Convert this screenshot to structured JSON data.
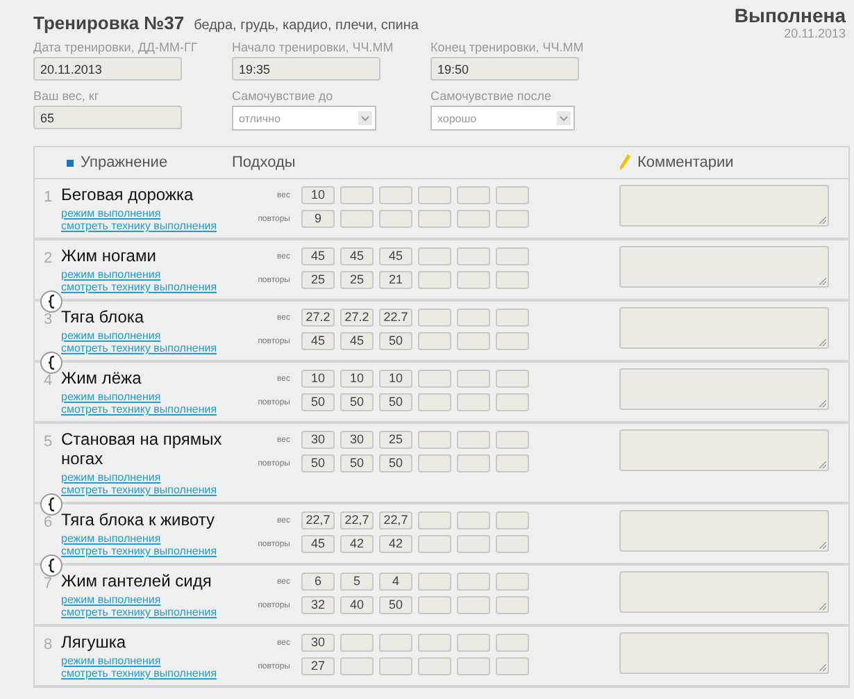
{
  "workout": {
    "title": "Тренировка №37",
    "muscles": "бедра, грудь, кардио, плечи, спина",
    "status": "Выполнена",
    "status_date": "20.11.2013"
  },
  "fields": [
    {
      "kind": "text",
      "label": "Дата тренировки, ДД-ММ-ГГ",
      "value": "20.11.2013"
    },
    {
      "kind": "text",
      "label": "Начало тренировки, ЧЧ.ММ",
      "value": "19:35"
    },
    {
      "kind": "text",
      "label": "Конец тренировки, ЧЧ.ММ",
      "value": "19:50"
    },
    {
      "kind": "text",
      "label": "Ваш вес, кг",
      "value": "65"
    },
    {
      "kind": "select",
      "label": "Самочувствие до",
      "value": "отлично"
    },
    {
      "kind": "select",
      "label": "Самочувствие после",
      "value": "хорошо"
    }
  ],
  "table": {
    "columns": [
      "Упражнение",
      "Подходы",
      "Комментарии"
    ],
    "rows": [
      {
        "number": "1",
        "name": "Беговая дорожка",
        "link_mode": "режим выполнения",
        "link_technique": "смотреть технику выполнения",
        "weight_label": "вес",
        "reps_label": "повторы",
        "weights": [
          "10"
        ],
        "reps": [
          "9"
        ],
        "superset_with_next": false
      },
      {
        "number": "2",
        "name": "Жим ногами",
        "link_mode": "режим выполнения",
        "link_technique": "смотреть технику выполнения",
        "weight_label": "вес",
        "reps_label": "повторы",
        "weights": [
          "45",
          "45",
          "45"
        ],
        "reps": [
          "25",
          "25",
          "21"
        ],
        "superset_with_next": true
      },
      {
        "number": "3",
        "name": "Тяга блока",
        "link_mode": "режим выполнения",
        "link_technique": "смотреть технику выполнения",
        "weight_label": "вес",
        "reps_label": "повторы",
        "weights": [
          "27.2",
          "27.2",
          "22.7"
        ],
        "reps": [
          "45",
          "45",
          "50"
        ],
        "superset_with_next": true
      },
      {
        "number": "4",
        "name": "Жим лёжа",
        "link_mode": "режим выполнения",
        "link_technique": "смотреть технику выполнения",
        "weight_label": "вес",
        "reps_label": "повторы",
        "weights": [
          "10",
          "10",
          "10"
        ],
        "reps": [
          "50",
          "50",
          "50"
        ],
        "superset_with_next": false
      },
      {
        "number": "5",
        "name": "Становая на прямых ногах",
        "link_mode": "режим выполнения",
        "link_technique": "смотреть технику выполнения",
        "weight_label": "вес",
        "reps_label": "повторы",
        "weights": [
          "30",
          "30",
          "25"
        ],
        "reps": [
          "50",
          "50",
          "50"
        ],
        "superset_with_next": true
      },
      {
        "number": "6",
        "name": "Тяга блока к животу",
        "link_mode": "режим выполнения",
        "link_technique": "смотреть технику выполнения",
        "weight_label": "вес",
        "reps_label": "повторы",
        "weights": [
          "22,7",
          "22,7",
          "22,7"
        ],
        "reps": [
          "45",
          "42",
          "42"
        ],
        "superset_with_next": true
      },
      {
        "number": "7",
        "name": "Жим гантелей сидя",
        "link_mode": "режим выполнения",
        "link_technique": "смотреть технику выполнения",
        "weight_label": "вес",
        "reps_label": "повторы",
        "weights": [
          "6",
          "5",
          "4"
        ],
        "reps": [
          "32",
          "40",
          "50"
        ],
        "superset_with_next": false
      },
      {
        "number": "8",
        "name": "Лягушка",
        "link_mode": "режим выполнения",
        "link_technique": "смотреть технику выполнения",
        "weight_label": "вес",
        "reps_label": "повторы",
        "weights": [
          "30"
        ],
        "reps": [
          "27"
        ],
        "superset_with_next": false
      }
    ]
  }
}
